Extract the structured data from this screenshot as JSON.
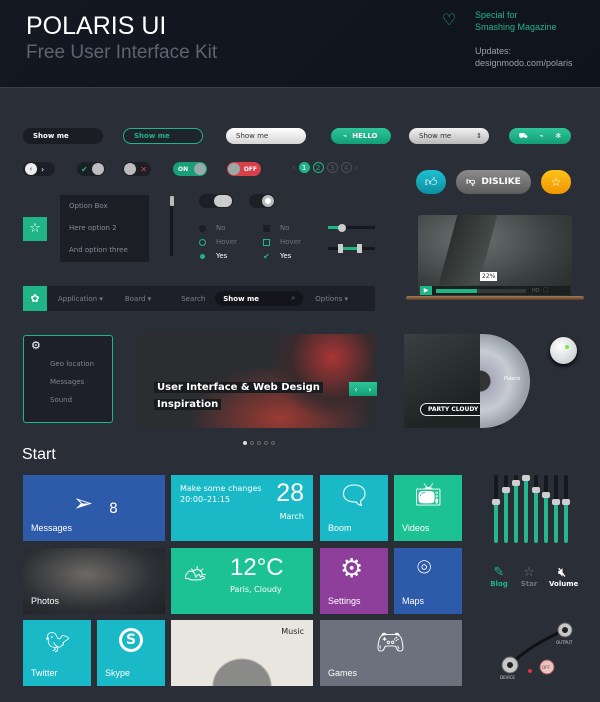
{
  "header": {
    "title": "POLARIS UI",
    "subtitle": "Free User Interface Kit",
    "special_line1": "Special for",
    "special_line2": "Smashing Magazine",
    "updates_label": "Updates:",
    "updates_url": "designmodo.com/polaris",
    "heart_icon": "heart-icon"
  },
  "row1": {
    "input_dark": "Show me",
    "input_outlined": "Show me",
    "input_light": "Show me",
    "hello_button": "HELLO",
    "select_value": "Show me"
  },
  "row2": {
    "toggle_on": "ON",
    "toggle_off": "OFF",
    "pages": [
      "1",
      "2",
      "3",
      "4"
    ],
    "current_page": "1"
  },
  "buttons": {
    "dislike": "DISLIKE"
  },
  "dropdown": {
    "options": [
      "Option Box",
      "Here option 2",
      "And option three"
    ]
  },
  "radios": [
    {
      "label": "No"
    },
    {
      "label": "Hover"
    },
    {
      "label": "Yes"
    }
  ],
  "checks": [
    {
      "label": "No"
    },
    {
      "label": "Hover"
    },
    {
      "label": "Yes"
    }
  ],
  "sliders": {
    "single_value": 0.3,
    "range": [
      0.25,
      0.65
    ]
  },
  "video": {
    "progress_label": "22%",
    "progress": 0.45
  },
  "navbar": {
    "items": [
      "Application",
      "Board"
    ],
    "search_label": "Search",
    "search_value": "Show me",
    "options": "Options"
  },
  "side_menu": {
    "items": [
      "Geo location",
      "Messages",
      "Sound"
    ]
  },
  "carousel": {
    "caption_line1": "User Interface & Web Design",
    "caption_line2": "Inspiration",
    "dots": 5,
    "active_dot": 0
  },
  "album": {
    "button": "PARTY CLOUDY",
    "disc_title": "Polaris"
  },
  "start": {
    "heading": "Start"
  },
  "tiles": {
    "messages": {
      "label": "Messages",
      "count": "8"
    },
    "calendar": {
      "event": "Make some changes",
      "time": "20:00–21:15",
      "day": "28",
      "month": "March"
    },
    "boom": "Boom",
    "videos": "Videos",
    "photos": "Photos",
    "weather": {
      "temp": "12°C",
      "location": "Paris, Cloudy"
    },
    "settings": "Settings",
    "maps": "Maps",
    "twitter": "Twitter",
    "skype": "Skype",
    "music": "Music",
    "games": "Games"
  },
  "equalizer": {
    "levels": [
      0.6,
      0.78,
      0.88,
      0.95,
      0.78,
      0.7,
      0.6,
      0.6
    ]
  },
  "icon_tabs": [
    {
      "label": "Blog",
      "active": true
    },
    {
      "label": "Star",
      "active": false
    },
    {
      "label": "Volume",
      "active": false
    }
  ],
  "cable": {
    "output": "OUTPUT",
    "device": "DEVICE",
    "off": "OFF"
  },
  "colors": {
    "accent": "#1fb587",
    "blue": "#2e5aaa",
    "cyan": "#1ab9c8",
    "purple": "#8e3f9c",
    "grey": "#6b727d"
  }
}
